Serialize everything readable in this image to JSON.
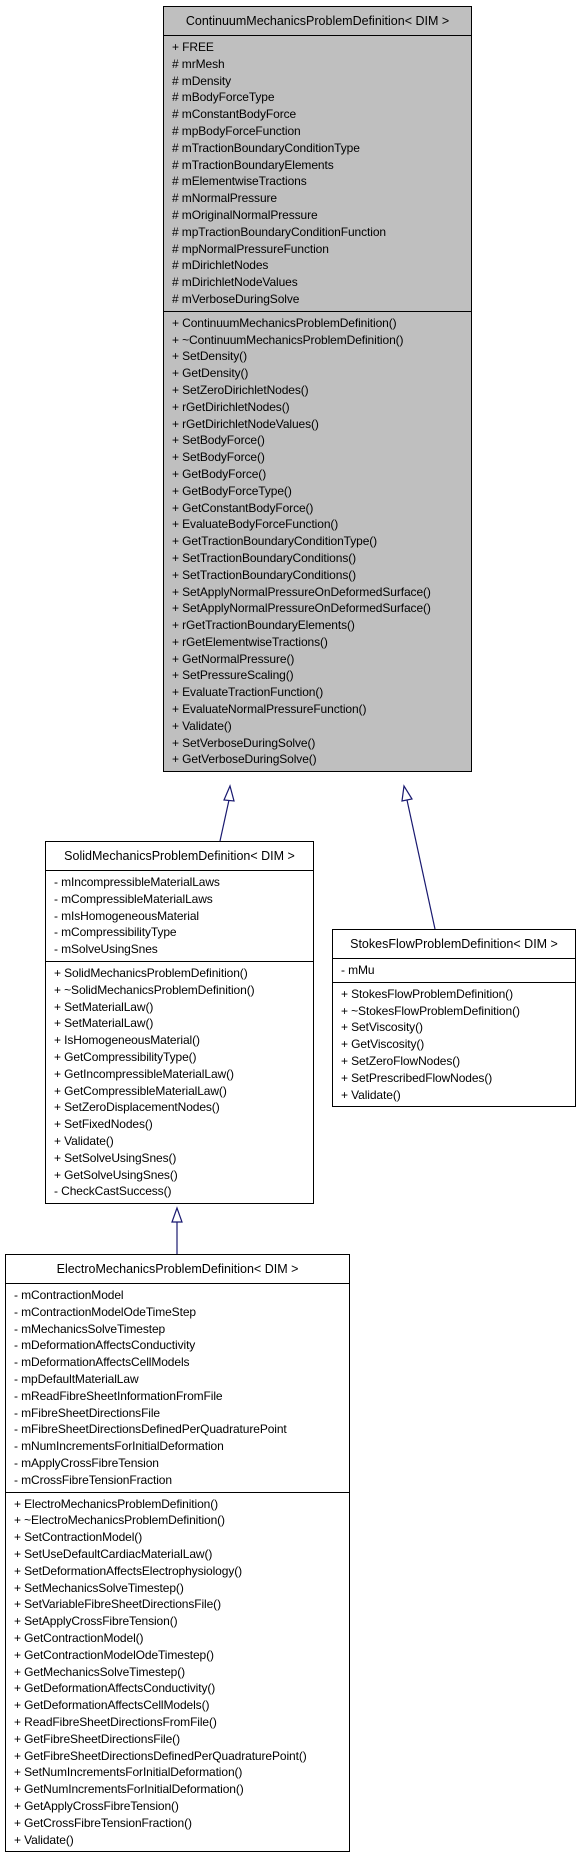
{
  "classes": {
    "continuum": {
      "name": "ContinuumMechanicsProblemDefinition< DIM >",
      "attributes": [
        "+ FREE",
        "# mrMesh",
        "# mDensity",
        "# mBodyForceType",
        "# mConstantBodyForce",
        "# mpBodyForceFunction",
        "# mTractionBoundaryConditionType",
        "# mTractionBoundaryElements",
        "# mElementwiseTractions",
        "# mNormalPressure",
        "# mOriginalNormalPressure",
        "# mpTractionBoundaryConditionFunction",
        "# mpNormalPressureFunction",
        "# mDirichletNodes",
        "# mDirichletNodeValues",
        "# mVerboseDuringSolve"
      ],
      "methods": [
        "+ ContinuumMechanicsProblemDefinition()",
        "+ ~ContinuumMechanicsProblemDefinition()",
        "+ SetDensity()",
        "+ GetDensity()",
        "+ SetZeroDirichletNodes()",
        "+ rGetDirichletNodes()",
        "+ rGetDirichletNodeValues()",
        "+ SetBodyForce()",
        "+ SetBodyForce()",
        "+ GetBodyForce()",
        "+ GetBodyForceType()",
        "+ GetConstantBodyForce()",
        "+ EvaluateBodyForceFunction()",
        "+ GetTractionBoundaryConditionType()",
        "+ SetTractionBoundaryConditions()",
        "+ SetTractionBoundaryConditions()",
        "+ SetApplyNormalPressureOnDeformedSurface()",
        "+ SetApplyNormalPressureOnDeformedSurface()",
        "+ rGetTractionBoundaryElements()",
        "+ rGetElementwiseTractions()",
        "+ GetNormalPressure()",
        "+ SetPressureScaling()",
        "+ EvaluateTractionFunction()",
        "+ EvaluateNormalPressureFunction()",
        "+ Validate()",
        "+ SetVerboseDuringSolve()",
        "+ GetVerboseDuringSolve()"
      ]
    },
    "solid": {
      "name": "SolidMechanicsProblemDefinition< DIM >",
      "attributes": [
        "- mIncompressibleMaterialLaws",
        "- mCompressibleMaterialLaws",
        "- mIsHomogeneousMaterial",
        "- mCompressibilityType",
        "- mSolveUsingSnes"
      ],
      "methods": [
        "+ SolidMechanicsProblemDefinition()",
        "+ ~SolidMechanicsProblemDefinition()",
        "+ SetMaterialLaw()",
        "+ SetMaterialLaw()",
        "+ IsHomogeneousMaterial()",
        "+ GetCompressibilityType()",
        "+ GetIncompressibleMaterialLaw()",
        "+ GetCompressibleMaterialLaw()",
        "+ SetZeroDisplacementNodes()",
        "+ SetFixedNodes()",
        "+ Validate()",
        "+ SetSolveUsingSnes()",
        "+ GetSolveUsingSnes()",
        "- CheckCastSuccess()"
      ]
    },
    "stokes": {
      "name": "StokesFlowProblemDefinition< DIM >",
      "attributes": [
        "- mMu"
      ],
      "methods": [
        "+ StokesFlowProblemDefinition()",
        "+ ~StokesFlowProblemDefinition()",
        "+ SetViscosity()",
        "+ GetViscosity()",
        "+ SetZeroFlowNodes()",
        "+ SetPrescribedFlowNodes()",
        "+ Validate()"
      ]
    },
    "electro": {
      "name": "ElectroMechanicsProblemDefinition< DIM >",
      "attributes": [
        "- mContractionModel",
        "- mContractionModelOdeTimeStep",
        "- mMechanicsSolveTimestep",
        "- mDeformationAffectsConductivity",
        "- mDeformationAffectsCellModels",
        "- mpDefaultMaterialLaw",
        "- mReadFibreSheetInformationFromFile",
        "- mFibreSheetDirectionsFile",
        "- mFibreSheetDirectionsDefinedPerQuadraturePoint",
        "- mNumIncrementsForInitialDeformation",
        "- mApplyCrossFibreTension",
        "- mCrossFibreTensionFraction"
      ],
      "methods": [
        "+ ElectroMechanicsProblemDefinition()",
        "+ ~ElectroMechanicsProblemDefinition()",
        "+ SetContractionModel()",
        "+ SetUseDefaultCardiacMaterialLaw()",
        "+ SetDeformationAffectsElectrophysiology()",
        "+ SetMechanicsSolveTimestep()",
        "+ SetVariableFibreSheetDirectionsFile()",
        "+ SetApplyCrossFibreTension()",
        "+ GetContractionModel()",
        "+ GetContractionModelOdeTimestep()",
        "+ GetMechanicsSolveTimestep()",
        "+ GetDeformationAffectsConductivity()",
        "+ GetDeformationAffectsCellModels()",
        "+ ReadFibreSheetDirectionsFromFile()",
        "+ GetFibreSheetDirectionsFile()",
        "+ GetFibreSheetDirectionsDefinedPerQuadraturePoint()",
        "+ SetNumIncrementsForInitialDeformation()",
        "+ GetNumIncrementsForInitialDeformation()",
        "+ GetApplyCrossFibreTension()",
        "+ GetCrossFibreTensionFraction()",
        "+ Validate()"
      ]
    }
  },
  "inheritance": [
    {
      "child": "solid",
      "parent": "continuum"
    },
    {
      "child": "stokes",
      "parent": "continuum"
    },
    {
      "child": "electro",
      "parent": "solid"
    }
  ],
  "colors": {
    "base_fill": "#bfbfbf",
    "edge": "#191970"
  }
}
